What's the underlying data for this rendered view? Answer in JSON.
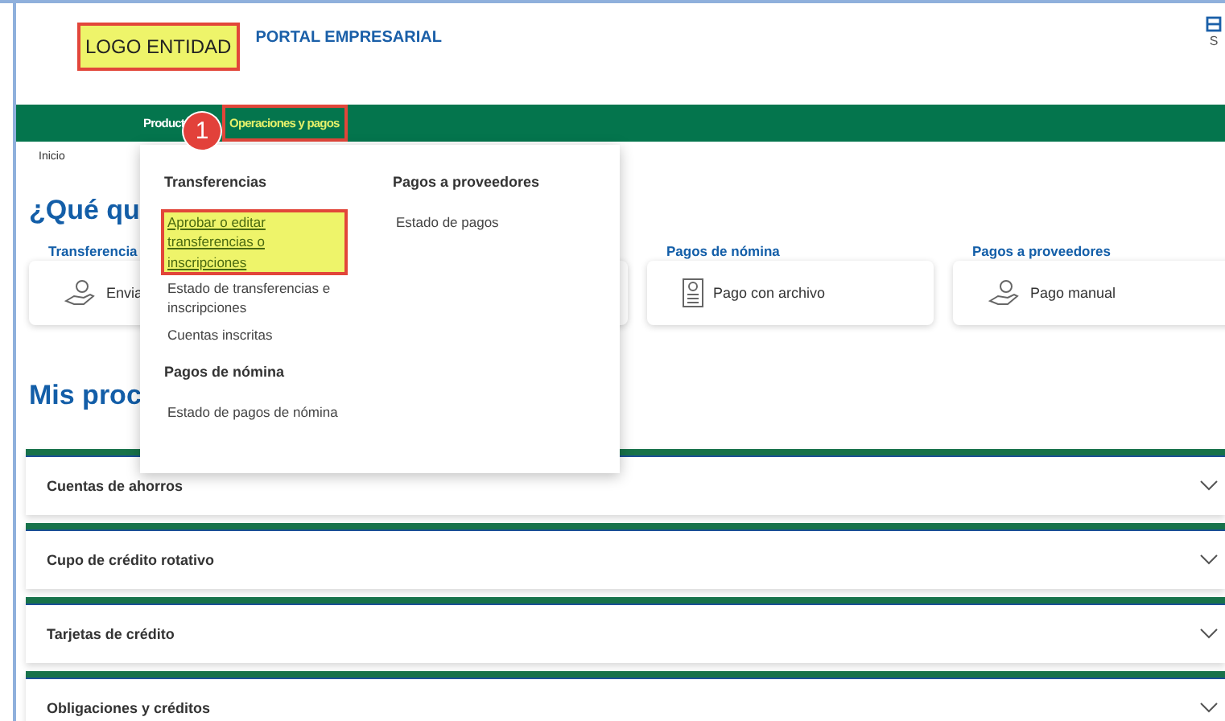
{
  "header": {
    "logo": "LOGO ENTIDAD",
    "logo_highlighted": true,
    "title": "PORTAL EMPRESARIAL",
    "corner_text": "S"
  },
  "nav": [
    {
      "label": "Product",
      "selected": false,
      "highlighted": false
    },
    {
      "label": "Operaciones y pagos",
      "selected": true,
      "highlighted": true
    }
  ],
  "badge": "1",
  "breadcrumb": "Inicio",
  "heading": "¿Qué qu",
  "quick_cards": [
    {
      "title": "Transferencia",
      "action": "Envia",
      "kind": "hand"
    },
    {
      "title": "Pagos de nómina",
      "action": "Pago con archivo",
      "kind": "document"
    },
    {
      "title": "Pagos a proveedores",
      "action": "Pago manual",
      "kind": "hand"
    }
  ],
  "products_heading": "Mis proc",
  "accordions": [
    {
      "label": "Cuentas de ahorros",
      "expanded": false
    },
    {
      "label": "Cupo de crédito rotativo",
      "expanded": false
    },
    {
      "label": "Tarjetas de crédito",
      "expanded": false
    },
    {
      "label": "Obligaciones y créditos",
      "expanded": false
    }
  ],
  "menu": {
    "columns": [
      {
        "groups": [
          {
            "title": "Transferencias",
            "links": [
              {
                "label": "Aprobar o editar transferencias o inscripciones",
                "highlighted": true
              },
              {
                "label": "Estado de transferencias e inscripciones",
                "highlighted": false
              },
              {
                "label": "Cuentas inscritas",
                "highlighted": false
              }
            ]
          },
          {
            "title": "Pagos de nómina",
            "links": [
              {
                "label": "Estado de pagos de nómina",
                "highlighted": false
              }
            ]
          }
        ]
      },
      {
        "groups": [
          {
            "title": "Pagos a proveedores",
            "links": [
              {
                "label": "Estado de pagos",
                "highlighted": false
              }
            ]
          }
        ]
      }
    ]
  }
}
